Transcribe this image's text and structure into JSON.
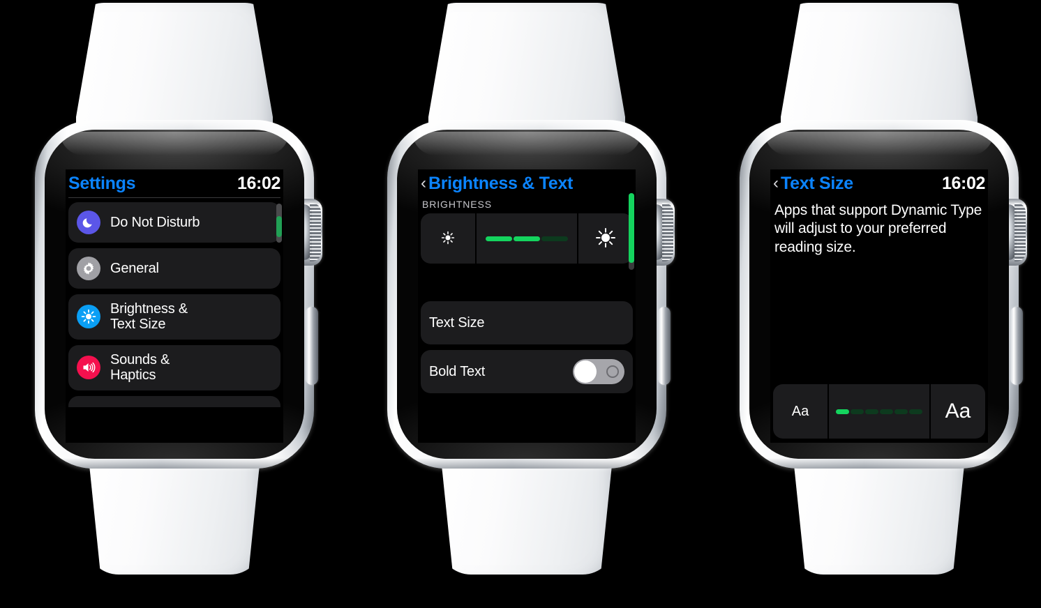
{
  "device": "apple-watch",
  "colors": {
    "accent_blue": "#0b84ff",
    "green_fill": "#14d45e",
    "green_track": "#0d3a1e",
    "row_bg": "#1c1c1e",
    "screen_bg": "#000000",
    "dnd_icon_bg": "#5b56e8",
    "general_icon_bg": "#a0a0a5",
    "brightness_icon_bg": "#0a9ff5",
    "sounds_icon_bg": "#f5104e",
    "toggle_off_track": "#a6a6ab"
  },
  "watches": [
    {
      "id": "settings",
      "header": {
        "title": "Settings",
        "time": "16:02",
        "back": false
      },
      "rows": [
        {
          "label": "Do Not Disturb",
          "icon": "moon-icon"
        },
        {
          "label": "General",
          "icon": "gear-icon"
        },
        {
          "label": "Brightness &\nText Size",
          "icon": "brightness-icon"
        },
        {
          "label": "Sounds &\nHaptics",
          "icon": "speaker-icon"
        }
      ],
      "scroll": {
        "thumb_top_pct": 12,
        "thumb_height_pct": 22
      }
    },
    {
      "id": "brightness-and-text",
      "header": {
        "title": "Brightness & Text",
        "time": "",
        "back": true,
        "back_glyph": "‹"
      },
      "group_label": "BRIGHTNESS",
      "brightness_slider": {
        "left_icon": "sun-small-icon",
        "right_icon": "sun-large-icon",
        "segments": 3,
        "filled": 2,
        "value_pct": 67
      },
      "rows": [
        {
          "label": "Text Size",
          "type": "link"
        },
        {
          "label": "Bold Text",
          "type": "toggle",
          "value": "off"
        }
      ],
      "scroll": {
        "thumb_top_pct": 0,
        "thumb_height_pct": 28
      }
    },
    {
      "id": "text-size",
      "header": {
        "title": "Text Size",
        "time": "16:02",
        "back": true,
        "back_glyph": "‹"
      },
      "body": "Apps that support Dynamic Type will adjust to your preferred reading size.",
      "text_size_slider": {
        "left_label": "Aa",
        "right_label": "Aa",
        "segments": 6,
        "filled": 1,
        "value_pct": 17
      }
    }
  ]
}
